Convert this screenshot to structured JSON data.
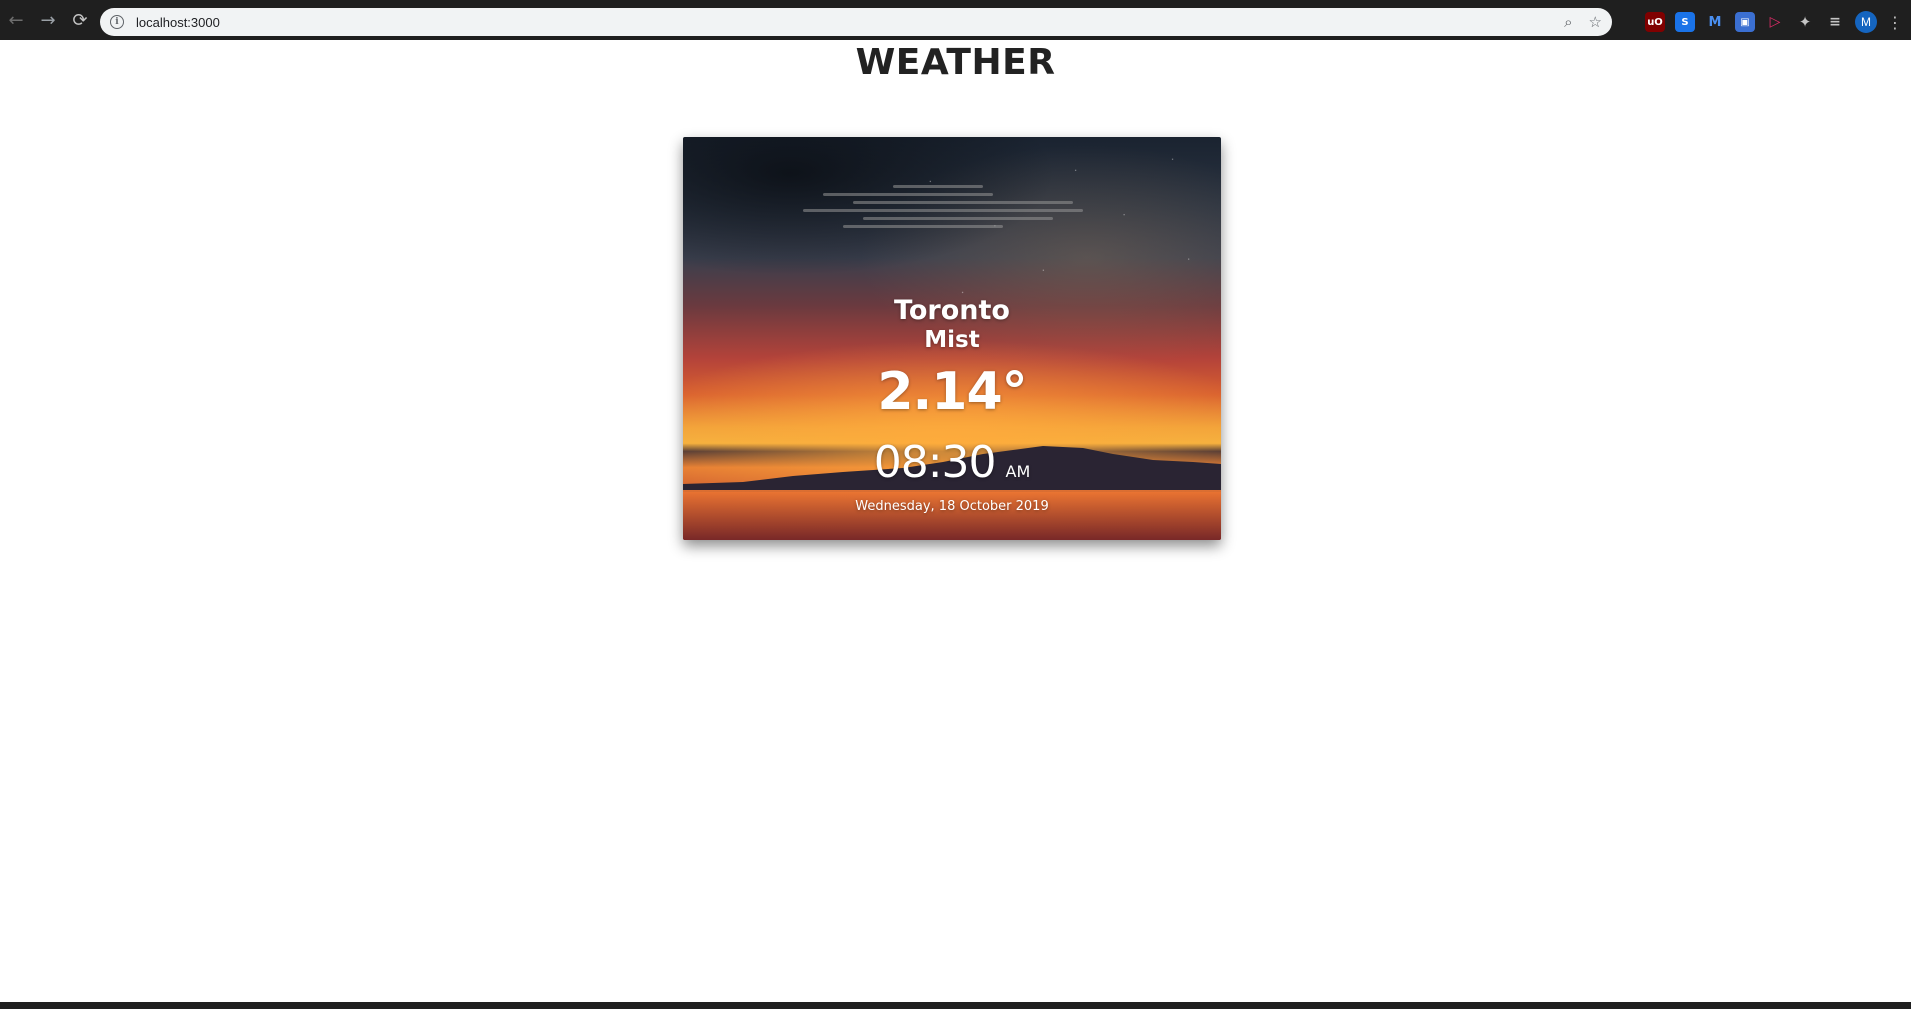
{
  "browser": {
    "url": "localhost:3000",
    "profile_initial": "M",
    "extensions": [
      {
        "icon": "ublock-icon",
        "label": "uO",
        "color": "#800000"
      },
      {
        "icon": "s-extension-icon",
        "label": "S",
        "color": "#1a73e8"
      },
      {
        "icon": "m-extension-icon",
        "label": "M",
        "color": "#1565c0"
      },
      {
        "icon": "screenshot-icon",
        "label": "▣",
        "color": "#3b6fd1"
      },
      {
        "icon": "play-icon",
        "label": "▶",
        "color": "#e52d6b"
      }
    ]
  },
  "page": {
    "title": "WEATHER"
  },
  "weather": {
    "city": "Toronto",
    "condition": "Mist",
    "temperature": "2.14°",
    "time": "08:30",
    "ampm": "AM",
    "date": "Wednesday, 18 October 2019",
    "icon": "mist-icon"
  }
}
